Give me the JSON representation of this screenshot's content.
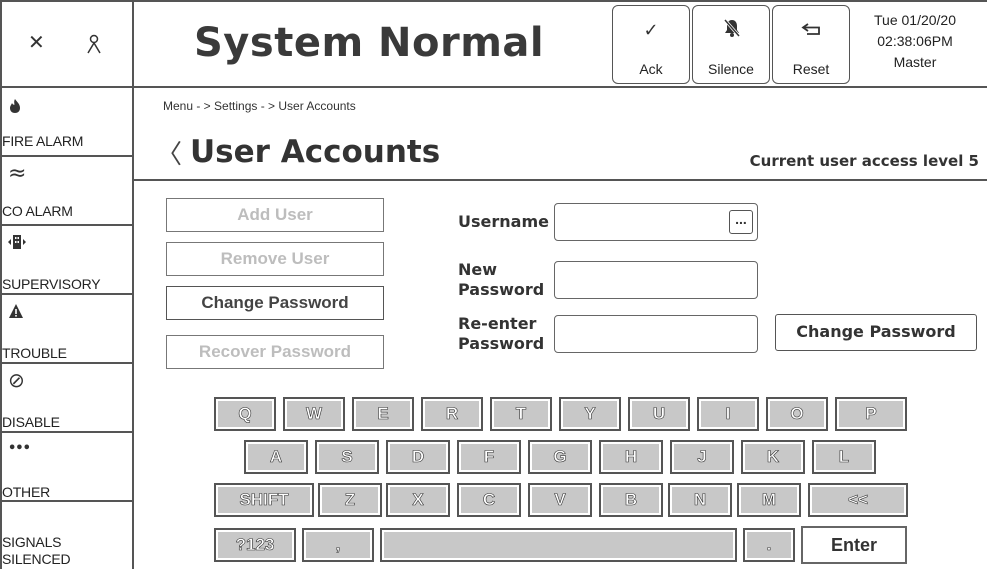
{
  "corner": {
    "close_glyph": "✕",
    "user_icon": "person-icon"
  },
  "sidebar": {
    "items": [
      {
        "icon": "flame-icon",
        "glyph": "🔥",
        "label": "FIRE ALARM"
      },
      {
        "icon": "waves-icon",
        "glyph": "≈",
        "label": "CO ALARM"
      },
      {
        "icon": "supervisory-icon",
        "glyph": "▦",
        "label": "SUPERVISORY"
      },
      {
        "icon": "warning-icon",
        "glyph": "▲",
        "label": "TROUBLE"
      },
      {
        "icon": "disable-icon",
        "glyph": "⊘",
        "label": "DISABLE"
      },
      {
        "icon": "more-icon",
        "glyph": "•••",
        "label": "OTHER"
      },
      {
        "icon": "",
        "glyph": "",
        "label": "SIGNALS SILENCED"
      }
    ]
  },
  "header": {
    "status": "System Normal",
    "buttons": [
      {
        "icon": "check-icon",
        "glyph": "✓",
        "label": "Ack"
      },
      {
        "icon": "bell-off-icon",
        "glyph": "🔕",
        "label": "Silence"
      },
      {
        "icon": "return-icon",
        "glyph": "↩",
        "label": "Reset"
      }
    ],
    "date": "Tue 01/20/20",
    "time": "02:38:06PM",
    "role": "Master"
  },
  "page": {
    "breadcrumb": "Menu  - > Settings - > User Accounts",
    "back_glyph": "〈",
    "title": "User Accounts",
    "access_level": "Current user access level  5"
  },
  "actions": {
    "add_user": "Add User",
    "remove_user": "Remove User",
    "change_password": "Change Password",
    "recover_password": "Recover Password"
  },
  "form": {
    "username_label": "Username",
    "username_value": "",
    "browse_glyph": "...",
    "new_password_label_1": "New",
    "new_password_label_2": "Password",
    "new_password_value": "",
    "reenter_label_1": "Re-enter",
    "reenter_label_2": "Password",
    "reenter_value": "",
    "submit_label": "Change Password"
  },
  "keyboard": {
    "row1": [
      "Q",
      "W",
      "E",
      "R",
      "T",
      "Y",
      "U",
      "I",
      "O",
      "P"
    ],
    "row2": [
      "A",
      "S",
      "D",
      "F",
      "G",
      "H",
      "J",
      "K",
      "L"
    ],
    "row3": [
      "SHIFT",
      "Z",
      "X",
      "C",
      "V",
      "B",
      "N",
      "M",
      "<<"
    ],
    "row4": [
      "?123",
      ",",
      "",
      ".",
      "Enter"
    ]
  }
}
